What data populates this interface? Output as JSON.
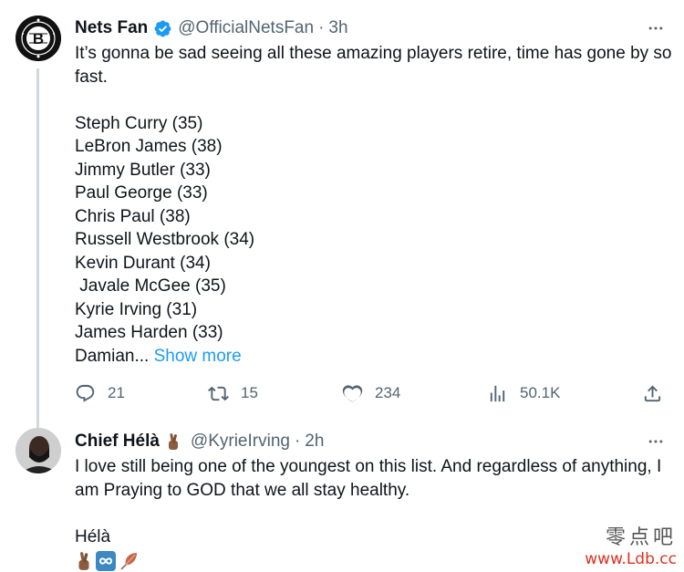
{
  "tweets": [
    {
      "author": {
        "name": "Nets Fan",
        "handle": "@OfficialNetsFan",
        "time": "3h",
        "verified": true,
        "avatar": "brooklyn-nets-logo"
      },
      "text_lines": [
        "It’s gonna be sad seeing all these amazing players retire, time has gone by so fast.",
        "",
        "Steph Curry (35)",
        "LeBron James (38)",
        "Jimmy Butler (33)",
        "Paul George (33)",
        "Chris Paul (38)",
        "Russell Westbrook (34)",
        "Kevin Durant (34)",
        " Javale McGee (35)",
        "Kyrie Irving (31)",
        "James Harden (33)"
      ],
      "truncated_line": "Damian...",
      "show_more": "Show more",
      "actions": {
        "replies": "21",
        "reposts": "15",
        "likes": "234",
        "views": "50.1K"
      }
    },
    {
      "author": {
        "name": "Chief Hélà",
        "handle": "@KyrieIrving",
        "time": "2h",
        "avatar": "profile-photo"
      },
      "text": "I love still being one of the youngest on this list. And regardless of anything, I am Praying to GOD that we all stay healthy.",
      "signature": "Hélà",
      "emojis": [
        "fingers-crossed-emoji",
        "infinity-emoji",
        "feather-emoji"
      ]
    }
  ],
  "separator": "·",
  "watermark": {
    "top": "零点吧",
    "bottom": "www.Ldb.cc"
  },
  "colors": {
    "accent": "#1d9bf0",
    "secondary_text": "#536471",
    "primary_text": "#0f1419",
    "divider": "#eff3f4",
    "thread_line": "#cfd9de"
  }
}
